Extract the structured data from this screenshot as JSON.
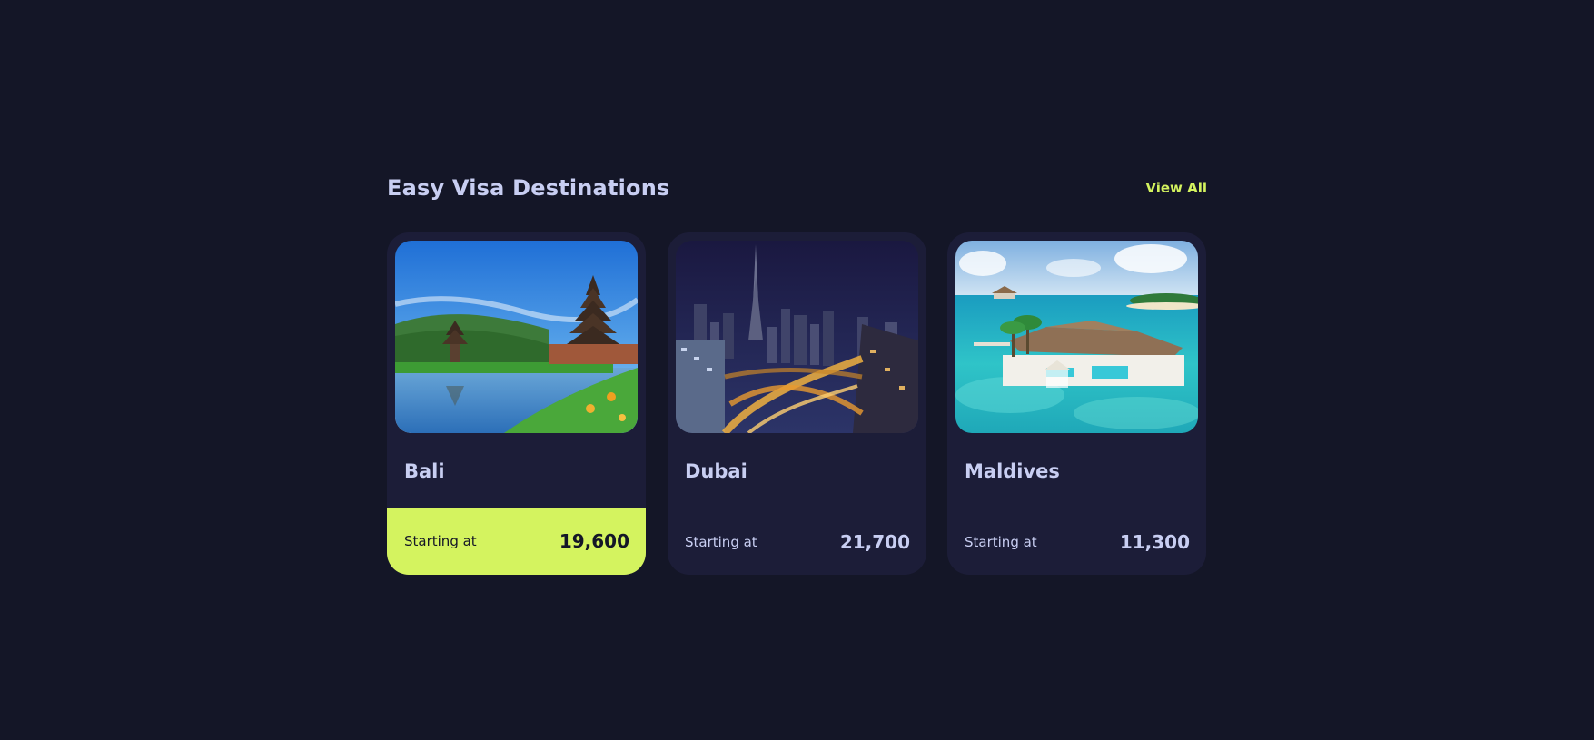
{
  "section": {
    "title": "Easy Visa Destinations",
    "view_all_label": "View All"
  },
  "destinations": [
    {
      "name": "Bali",
      "starting_label": "Starting at",
      "price": "19,600",
      "highlighted": true,
      "image": "bali-temple-lake-photo"
    },
    {
      "name": "Dubai",
      "starting_label": "Starting at",
      "price": "21,700",
      "highlighted": false,
      "image": "dubai-night-skyline-photo"
    },
    {
      "name": "Maldives",
      "starting_label": "Starting at",
      "price": "11,300",
      "highlighted": false,
      "image": "maldives-overwater-villa-photo"
    }
  ],
  "colors": {
    "background": "#141627",
    "card": "#1c1d38",
    "accent": "#d4f35f",
    "text": "#c8cef2"
  }
}
